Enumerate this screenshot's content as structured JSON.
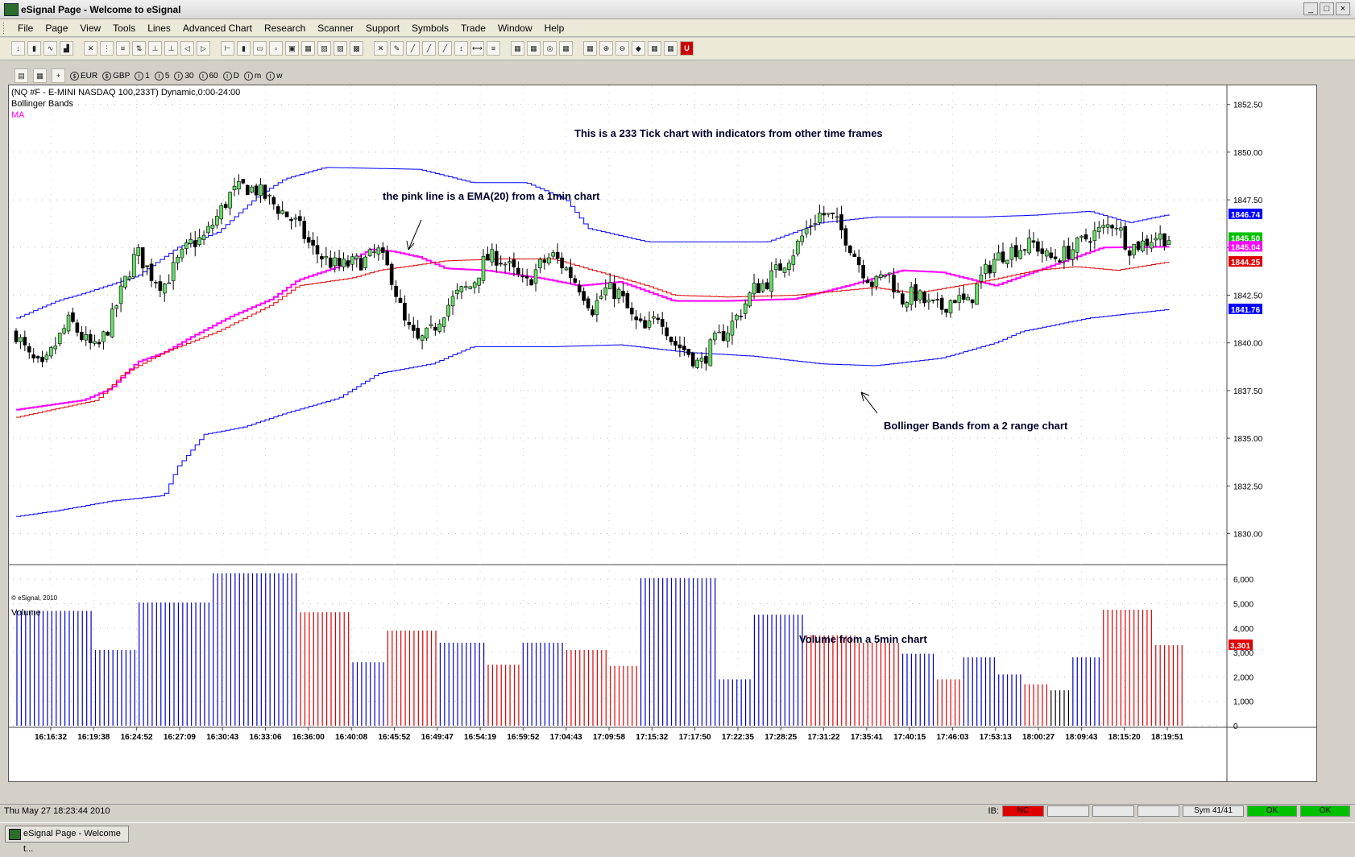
{
  "window": {
    "title": "eSignal Page - Welcome to eSignal",
    "controls": [
      "_",
      "□",
      "×"
    ]
  },
  "menu": [
    "File",
    "Page",
    "View",
    "Tools",
    "Lines",
    "Advanced Chart",
    "Research",
    "Scanner",
    "Support",
    "Symbols",
    "Trade",
    "Window",
    "Help"
  ],
  "toolbar2": {
    "chips": [
      "EUR",
      "GBP",
      "1",
      "5",
      "30",
      "60",
      "D",
      "m",
      "w"
    ]
  },
  "chart": {
    "symbol_label": "(NQ #F - E-MINI NASDAQ 100,233T) Dynamic,0:00-24:00",
    "bb_label": "Bollinger Bands",
    "ma_label": "MA",
    "copyright": "© eSignal, 2010",
    "volume_label": "Volume",
    "note_title": "This is a 233 Tick  chart with indicators from other time frames",
    "note_ema": "the pink line is a EMA(20) from a 1min chart",
    "note_bb": "Bollinger Bands from a 2 range chart",
    "note_vol": "Volume from a 5min chart",
    "price_labels": [
      {
        "text": "1846.74",
        "value": 1846.74,
        "color": "#0000ff"
      },
      {
        "text": "1845.50",
        "value": 1845.5,
        "color": "#00c000"
      },
      {
        "text": "1845.04",
        "value": 1845.04,
        "color": "#ff00ff"
      },
      {
        "text": "1844.25",
        "value": 1844.25,
        "color": "#e00000"
      },
      {
        "text": "1841.76",
        "value": 1841.76,
        "color": "#0000ff"
      }
    ],
    "volume_label_current": {
      "text": "3,301",
      "value": 3301,
      "color": "#e00000"
    }
  },
  "chart_data": {
    "type": "candlestick",
    "y_axis": {
      "min": 1828.5,
      "max": 1853.5,
      "ticks": [
        "1852.50",
        "1850.00",
        "1847.50",
        "1845.00",
        "1842.50",
        "1840.00",
        "1837.50",
        "1835.00",
        "1832.50",
        "1830.00"
      ],
      "tick_values": [
        1852.5,
        1850,
        1847.5,
        1845,
        1842.5,
        1840,
        1837.5,
        1835,
        1832.5,
        1830
      ]
    },
    "volume_axis": {
      "min": 0,
      "max": 6500,
      "ticks": [
        "6,000",
        "5,000",
        "4,000",
        "3,000",
        "2,000",
        "1,000",
        "0"
      ],
      "tick_values": [
        6000,
        5000,
        4000,
        3000,
        2000,
        1000,
        0
      ]
    },
    "x_ticks": [
      "16:16:32",
      "16:19:38",
      "16:24:52",
      "16:27:09",
      "16:30:43",
      "16:33:06",
      "16:36:00",
      "16:40:08",
      "16:45:52",
      "16:49:47",
      "16:54:19",
      "16:59:52",
      "17:04:43",
      "17:09:58",
      "17:15:32",
      "17:17:50",
      "17:22:35",
      "17:28:25",
      "17:31:22",
      "17:35:41",
      "17:40:15",
      "17:46:03",
      "17:53:13",
      "18:00:27",
      "18:09:43",
      "18:15:20",
      "18:19:51"
    ],
    "bar_count": 265,
    "close_waypoints": [
      [
        0,
        1840.5
      ],
      [
        5,
        1839.2
      ],
      [
        10,
        1838.6
      ],
      [
        15,
        1840.0
      ],
      [
        20,
        1841.2
      ],
      [
        25,
        1840.2
      ],
      [
        30,
        1839.6
      ],
      [
        35,
        1841.0
      ],
      [
        40,
        1843.0
      ],
      [
        45,
        1844.8
      ],
      [
        50,
        1843.6
      ],
      [
        55,
        1843.0
      ],
      [
        60,
        1844.2
      ],
      [
        65,
        1845.2
      ],
      [
        70,
        1845.5
      ],
      [
        75,
        1846.6
      ],
      [
        80,
        1847.8
      ],
      [
        85,
        1848.2
      ],
      [
        90,
        1848.0
      ],
      [
        95,
        1847.4
      ],
      [
        100,
        1846.8
      ],
      [
        105,
        1846.2
      ],
      [
        110,
        1845.0
      ],
      [
        115,
        1844.4
      ],
      [
        120,
        1844.0
      ],
      [
        130,
        1844.3
      ],
      [
        135,
        1844.8
      ],
      [
        140,
        1843.5
      ],
      [
        145,
        1841.0
      ],
      [
        150,
        1840.0
      ],
      [
        155,
        1840.6
      ],
      [
        160,
        1841.8
      ],
      [
        165,
        1842.6
      ],
      [
        170,
        1843.0
      ],
      [
        175,
        1844.4
      ],
      [
        180,
        1844.5
      ],
      [
        185,
        1843.8
      ],
      [
        190,
        1843.0
      ],
      [
        195,
        1844.0
      ],
      [
        200,
        1844.6
      ],
      [
        205,
        1843.9
      ],
      [
        210,
        1843.0
      ],
      [
        215,
        1841.8
      ],
      [
        220,
        1842.8
      ],
      [
        225,
        1842.6
      ],
      [
        230,
        1841.2
      ],
      [
        235,
        1840.6
      ],
      [
        240,
        1841.6
      ],
      [
        245,
        1840.0
      ],
      [
        250,
        1839.6
      ],
      [
        255,
        1838.8
      ],
      [
        260,
        1840.0
      ],
      [
        265,
        1840.6
      ],
      [
        270,
        1841.6
      ],
      [
        275,
        1842.8
      ],
      [
        280,
        1843.2
      ],
      [
        285,
        1844.0
      ],
      [
        290,
        1844.8
      ],
      [
        295,
        1846.0
      ],
      [
        300,
        1846.8
      ],
      [
        305,
        1846.5
      ],
      [
        310,
        1845.4
      ],
      [
        315,
        1844.0
      ],
      [
        320,
        1843.0
      ],
      [
        325,
        1843.8
      ],
      [
        330,
        1842.2
      ],
      [
        335,
        1842.6
      ],
      [
        340,
        1842.0
      ],
      [
        345,
        1841.8
      ],
      [
        350,
        1842.4
      ],
      [
        355,
        1842.0
      ],
      [
        360,
        1843.4
      ],
      [
        365,
        1844.4
      ],
      [
        370,
        1844.8
      ],
      [
        375,
        1845.0
      ],
      [
        380,
        1845.2
      ],
      [
        385,
        1844.4
      ],
      [
        390,
        1844.6
      ],
      [
        395,
        1845.0
      ],
      [
        400,
        1845.6
      ],
      [
        405,
        1845.9
      ],
      [
        410,
        1846.4
      ],
      [
        415,
        1845.0
      ],
      [
        420,
        1845.2
      ],
      [
        425,
        1845.6
      ],
      [
        430,
        1845.5
      ]
    ],
    "series": [
      {
        "name": "Bollinger Bands",
        "color": "#0000ff",
        "waypoints": [
          [
            0,
            1841.3
          ],
          [
            15,
            1842.2
          ],
          [
            25,
            1842.6
          ],
          [
            45,
            1843.5
          ],
          [
            60,
            1845.0
          ],
          [
            75,
            1845.8
          ],
          [
            90,
            1847.7
          ],
          [
            100,
            1848.6
          ],
          [
            115,
            1849.2
          ],
          [
            150,
            1849.1
          ],
          [
            170,
            1848.4
          ],
          [
            190,
            1848.4
          ],
          [
            205,
            1847.5
          ],
          [
            213,
            1846.0
          ],
          [
            235,
            1845.3
          ],
          [
            280,
            1845.3
          ],
          [
            300,
            1846.3
          ],
          [
            320,
            1846.6
          ],
          [
            360,
            1846.6
          ],
          [
            380,
            1846.7
          ],
          [
            400,
            1846.9
          ],
          [
            415,
            1846.3
          ],
          [
            430,
            1846.74
          ]
        ]
      },
      {
        "name": "Bollinger Bands",
        "color": "#0000ff",
        "waypoints": [
          [
            0,
            1830.9
          ],
          [
            15,
            1831.2
          ],
          [
            35,
            1831.7
          ],
          [
            55,
            1832.0
          ],
          [
            60,
            1833.5
          ],
          [
            70,
            1835.2
          ],
          [
            85,
            1835.6
          ],
          [
            100,
            1836.3
          ],
          [
            120,
            1837.1
          ],
          [
            135,
            1838.4
          ],
          [
            155,
            1838.9
          ],
          [
            170,
            1839.8
          ],
          [
            200,
            1839.8
          ],
          [
            225,
            1839.9
          ],
          [
            250,
            1839.5
          ],
          [
            275,
            1839.3
          ],
          [
            300,
            1838.9
          ],
          [
            320,
            1838.8
          ],
          [
            345,
            1839.2
          ],
          [
            365,
            1840.0
          ],
          [
            375,
            1840.6
          ],
          [
            400,
            1841.3
          ],
          [
            430,
            1841.76
          ]
        ]
      },
      {
        "name": "MA",
        "color": "#ff00ff",
        "waypoints": [
          [
            0,
            1836.5
          ],
          [
            25,
            1837.0
          ],
          [
            35,
            1837.6
          ],
          [
            45,
            1839.0
          ],
          [
            55,
            1839.5
          ],
          [
            65,
            1840.3
          ],
          [
            80,
            1841.4
          ],
          [
            95,
            1842.3
          ],
          [
            105,
            1843.3
          ],
          [
            120,
            1844.0
          ],
          [
            132,
            1844.9
          ],
          [
            140,
            1844.8
          ],
          [
            150,
            1844.5
          ],
          [
            160,
            1843.9
          ],
          [
            175,
            1843.8
          ],
          [
            195,
            1843.4
          ],
          [
            210,
            1843.0
          ],
          [
            225,
            1843.2
          ],
          [
            245,
            1842.2
          ],
          [
            265,
            1842.2
          ],
          [
            290,
            1842.3
          ],
          [
            310,
            1843.0
          ],
          [
            330,
            1843.8
          ],
          [
            345,
            1843.7
          ],
          [
            365,
            1843.0
          ],
          [
            385,
            1844.0
          ],
          [
            405,
            1845.0
          ],
          [
            430,
            1845.04
          ]
        ]
      },
      {
        "name": "MA",
        "color": "#e00000",
        "waypoints": [
          [
            0,
            1836.1
          ],
          [
            30,
            1837.0
          ],
          [
            40,
            1838.4
          ],
          [
            55,
            1839.5
          ],
          [
            75,
            1840.6
          ],
          [
            95,
            1842.0
          ],
          [
            105,
            1843.0
          ],
          [
            125,
            1843.4
          ],
          [
            135,
            1843.8
          ],
          [
            145,
            1844.0
          ],
          [
            160,
            1844.3
          ],
          [
            180,
            1844.4
          ],
          [
            200,
            1844.4
          ],
          [
            215,
            1843.8
          ],
          [
            235,
            1843.0
          ],
          [
            245,
            1842.5
          ],
          [
            265,
            1842.4
          ],
          [
            290,
            1842.5
          ],
          [
            320,
            1842.9
          ],
          [
            335,
            1842.6
          ],
          [
            360,
            1843.2
          ],
          [
            380,
            1843.8
          ],
          [
            395,
            1844.0
          ],
          [
            410,
            1843.8
          ],
          [
            430,
            1844.25
          ]
        ]
      }
    ],
    "volume_blocks": [
      {
        "n": 18,
        "value": 4700,
        "color": "#0000cc"
      },
      {
        "n": 10,
        "value": 3100,
        "color": "#0000cc"
      },
      {
        "n": 17,
        "value": 5050,
        "color": "#0000cc"
      },
      {
        "n": 20,
        "value": 6250,
        "color": "#0000cc"
      },
      {
        "n": 12,
        "value": 4650,
        "color": "#e00000"
      },
      {
        "n": 8,
        "value": 2600,
        "color": "#0000cc"
      },
      {
        "n": 12,
        "value": 3900,
        "color": "#e00000"
      },
      {
        "n": 11,
        "value": 3400,
        "color": "#0000cc"
      },
      {
        "n": 8,
        "value": 2500,
        "color": "#e00000"
      },
      {
        "n": 10,
        "value": 3400,
        "color": "#0000cc"
      },
      {
        "n": 10,
        "value": 3100,
        "color": "#e00000"
      },
      {
        "n": 7,
        "value": 2450,
        "color": "#e00000"
      },
      {
        "n": 18,
        "value": 6050,
        "color": "#0000cc"
      },
      {
        "n": 8,
        "value": 1900,
        "color": "#0000cc"
      },
      {
        "n": 12,
        "value": 4550,
        "color": "#0000cc"
      },
      {
        "n": 12,
        "value": 3700,
        "color": "#e00000"
      },
      {
        "n": 10,
        "value": 3400,
        "color": "#e00000"
      },
      {
        "n": 8,
        "value": 2950,
        "color": "#0000cc"
      },
      {
        "n": 6,
        "value": 1900,
        "color": "#e00000"
      },
      {
        "n": 8,
        "value": 2800,
        "color": "#0000cc"
      },
      {
        "n": 6,
        "value": 2100,
        "color": "#0000cc"
      },
      {
        "n": 6,
        "value": 1700,
        "color": "#e00000"
      },
      {
        "n": 5,
        "value": 1450,
        "color": "#000000"
      },
      {
        "n": 7,
        "value": 2800,
        "color": "#0000cc"
      },
      {
        "n": 12,
        "value": 4750,
        "color": "#e00000"
      },
      {
        "n": 7,
        "value": 3301,
        "color": "#e00000"
      }
    ]
  },
  "status": {
    "datetime": "Thu May 27 18:23:44 2010",
    "ib_label": "IB:",
    "nc": "NC",
    "sym": "Sym 41/41",
    "ok1": "OK",
    "ok2": "OK"
  },
  "taskbar": {
    "item": "eSignal Page - Welcome t..."
  }
}
